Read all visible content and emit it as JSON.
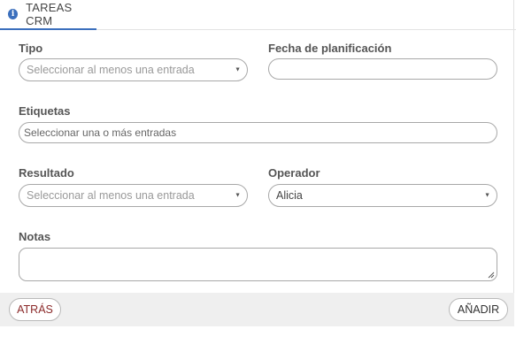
{
  "tab": {
    "title": "TAREAS CRM",
    "icon": "info-icon"
  },
  "form": {
    "tipo": {
      "label": "Tipo",
      "placeholder": "Seleccionar al menos una entrada"
    },
    "fecha": {
      "label": "Fecha de planificación",
      "value": ""
    },
    "etiquetas": {
      "label": "Etiquetas",
      "placeholder": "Seleccionar una o más entradas"
    },
    "resultado": {
      "label": "Resultado",
      "placeholder": "Seleccionar al menos una entrada"
    },
    "operador": {
      "label": "Operador",
      "value": "Alicia"
    },
    "notas": {
      "label": "Notas",
      "value": ""
    }
  },
  "footer": {
    "back_label": "ATRÁS",
    "add_label": "AÑADIR"
  },
  "colors": {
    "accent": "#3b6fbd",
    "back_text": "#8b2a2a",
    "footer_bg": "#efefef"
  }
}
